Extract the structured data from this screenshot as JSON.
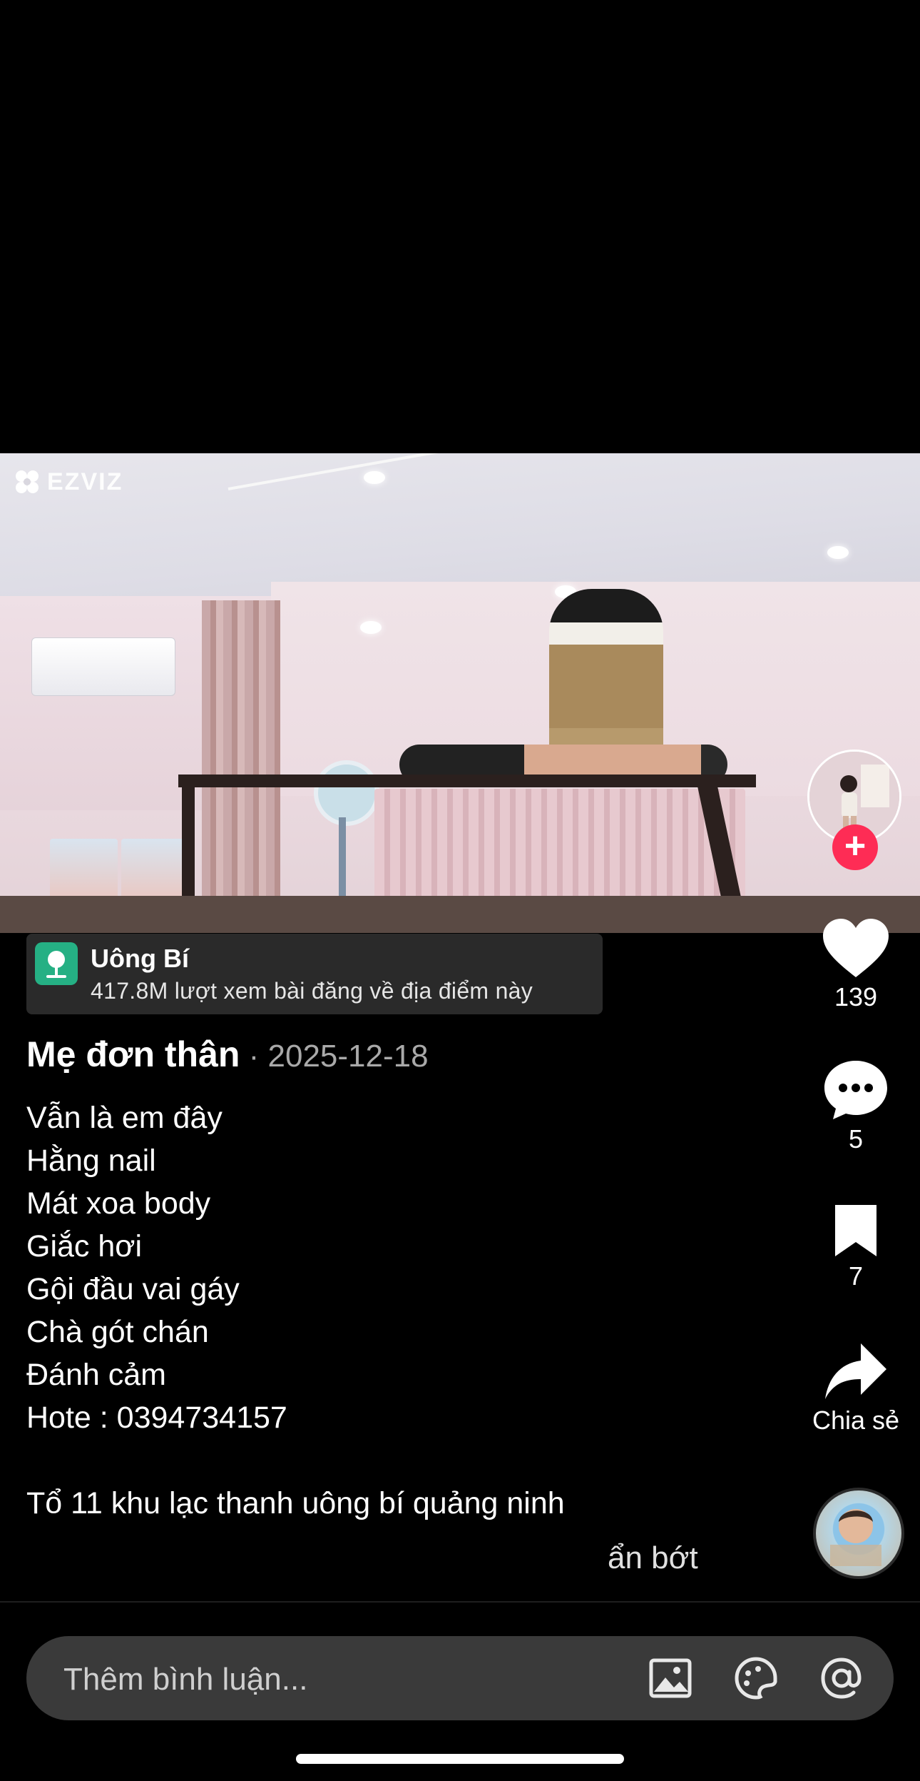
{
  "video": {
    "watermark": "EZVIZ"
  },
  "location": {
    "title": "Uông Bí",
    "subtitle": "417.8M lượt xem bài đăng về địa điểm này"
  },
  "post": {
    "author": "Mẹ đơn thân",
    "date": " · 2025-12-18",
    "caption_lines": [
      "Vẫn là em đây",
      "Hằng nail",
      "Mát xoa body",
      "Giắc hơi",
      "Gội đầu vai gáy",
      "Chà gót chán",
      "Đánh cảm",
      "Hote : 0394734157"
    ],
    "address": "Tổ 11 khu lạc thanh uông bí quảng ninh",
    "collapse_label": "ẩn bớt"
  },
  "actions": {
    "likes": "139",
    "comments": "5",
    "saves": "7",
    "share_label": "Chia sẻ"
  },
  "comment_bar": {
    "placeholder": "Thêm bình luận..."
  },
  "colors": {
    "follow_plus": "#fe2c55",
    "location_pin": "#25b084"
  }
}
